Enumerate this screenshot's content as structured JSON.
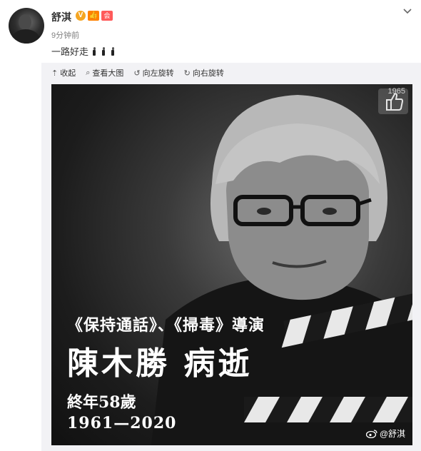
{
  "post": {
    "user_name": "舒淇",
    "badges": [
      "V",
      "👍",
      "会员"
    ],
    "time": "9分钟前",
    "text": "一路好走",
    "candles": 3
  },
  "toolbar": {
    "collapse_label": "收起",
    "view_large_label": "查看大图",
    "rotate_left_label": "向左旋转",
    "rotate_right_label": "向右旋转"
  },
  "image": {
    "counter": "1965",
    "caption_line1": "《保持通話》、《掃毒》導演",
    "caption_line2": "陳木勝 病逝",
    "caption_line3": "終年58歲",
    "caption_line4": "1961—2020",
    "watermark": "@舒淇"
  },
  "colors": {
    "accent": "#ff8200",
    "panel_bg": "#f2f2f5",
    "text": "#333333",
    "muted": "#808080"
  }
}
